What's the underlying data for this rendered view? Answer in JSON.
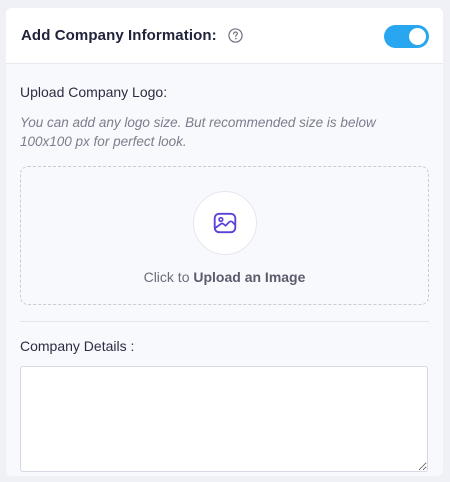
{
  "header": {
    "title": "Add Company Information:",
    "help_icon": "question-circle-icon",
    "toggle_on": true,
    "toggle_color": "#29a6f0"
  },
  "logo": {
    "label": "Upload Company Logo:",
    "hint": "You can add any logo size. But recommended size is below 100x100 px for perfect look.",
    "upload_icon": "image-icon",
    "upload_prefix": "Click to",
    "upload_action": "Upload an Image",
    "accent_color": "#5b3fd8"
  },
  "details": {
    "label": "Company Details :",
    "value": "",
    "placeholder": ""
  }
}
